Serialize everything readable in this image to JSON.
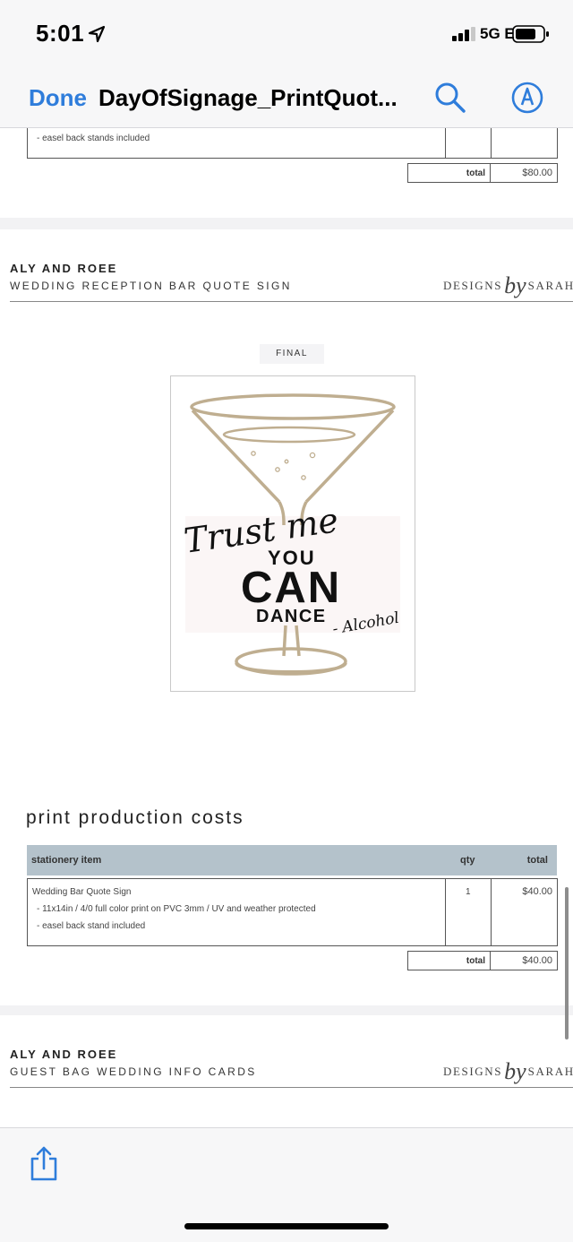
{
  "status_bar": {
    "time": "5:01",
    "network": "5G E"
  },
  "nav": {
    "done_label": "Done",
    "title": "DayOfSignage_PrintQuot..."
  },
  "page1": {
    "item_line": "- easel back stands included",
    "total_label": "total",
    "total_value": "$80.00"
  },
  "page2": {
    "client": "ALY AND ROEE",
    "subtitle": "WEDDING RECEPTION BAR QUOTE SIGN",
    "logo_left": "DESIGNS",
    "logo_by": "by",
    "logo_right": "SARAH",
    "final_label": "FINAL",
    "sign": {
      "script": "Trust me",
      "you": "YOU",
      "can": "CAN",
      "dance": "DANCE",
      "attribution": "- Alcohol"
    },
    "section_title": "print production costs",
    "table": {
      "col_item": "stationery item",
      "col_qty": "qty",
      "col_total": "total",
      "item_name": "Wedding Bar Quote Sign",
      "item_line1": "- 11x14in  /  4/0 full color print on PVC 3mm  /  UV and weather protected",
      "item_line2": "- easel back stand included",
      "qty": "1",
      "item_total": "$40.00",
      "total_label": "total",
      "total_value": "$40.00"
    }
  },
  "page3": {
    "client": "ALY AND ROEE",
    "subtitle": "GUEST BAG WEDDING INFO CARDS",
    "logo_left": "DESIGNS",
    "logo_by": "by",
    "logo_right": "SARAH"
  },
  "colors": {
    "accent": "#2f7ddb",
    "table_header": "#b4c2cb",
    "glass": "#bfae90"
  },
  "icons": [
    "location-arrow-icon",
    "signal-icon",
    "battery-icon",
    "search-icon",
    "markup-icon",
    "share-icon"
  ]
}
